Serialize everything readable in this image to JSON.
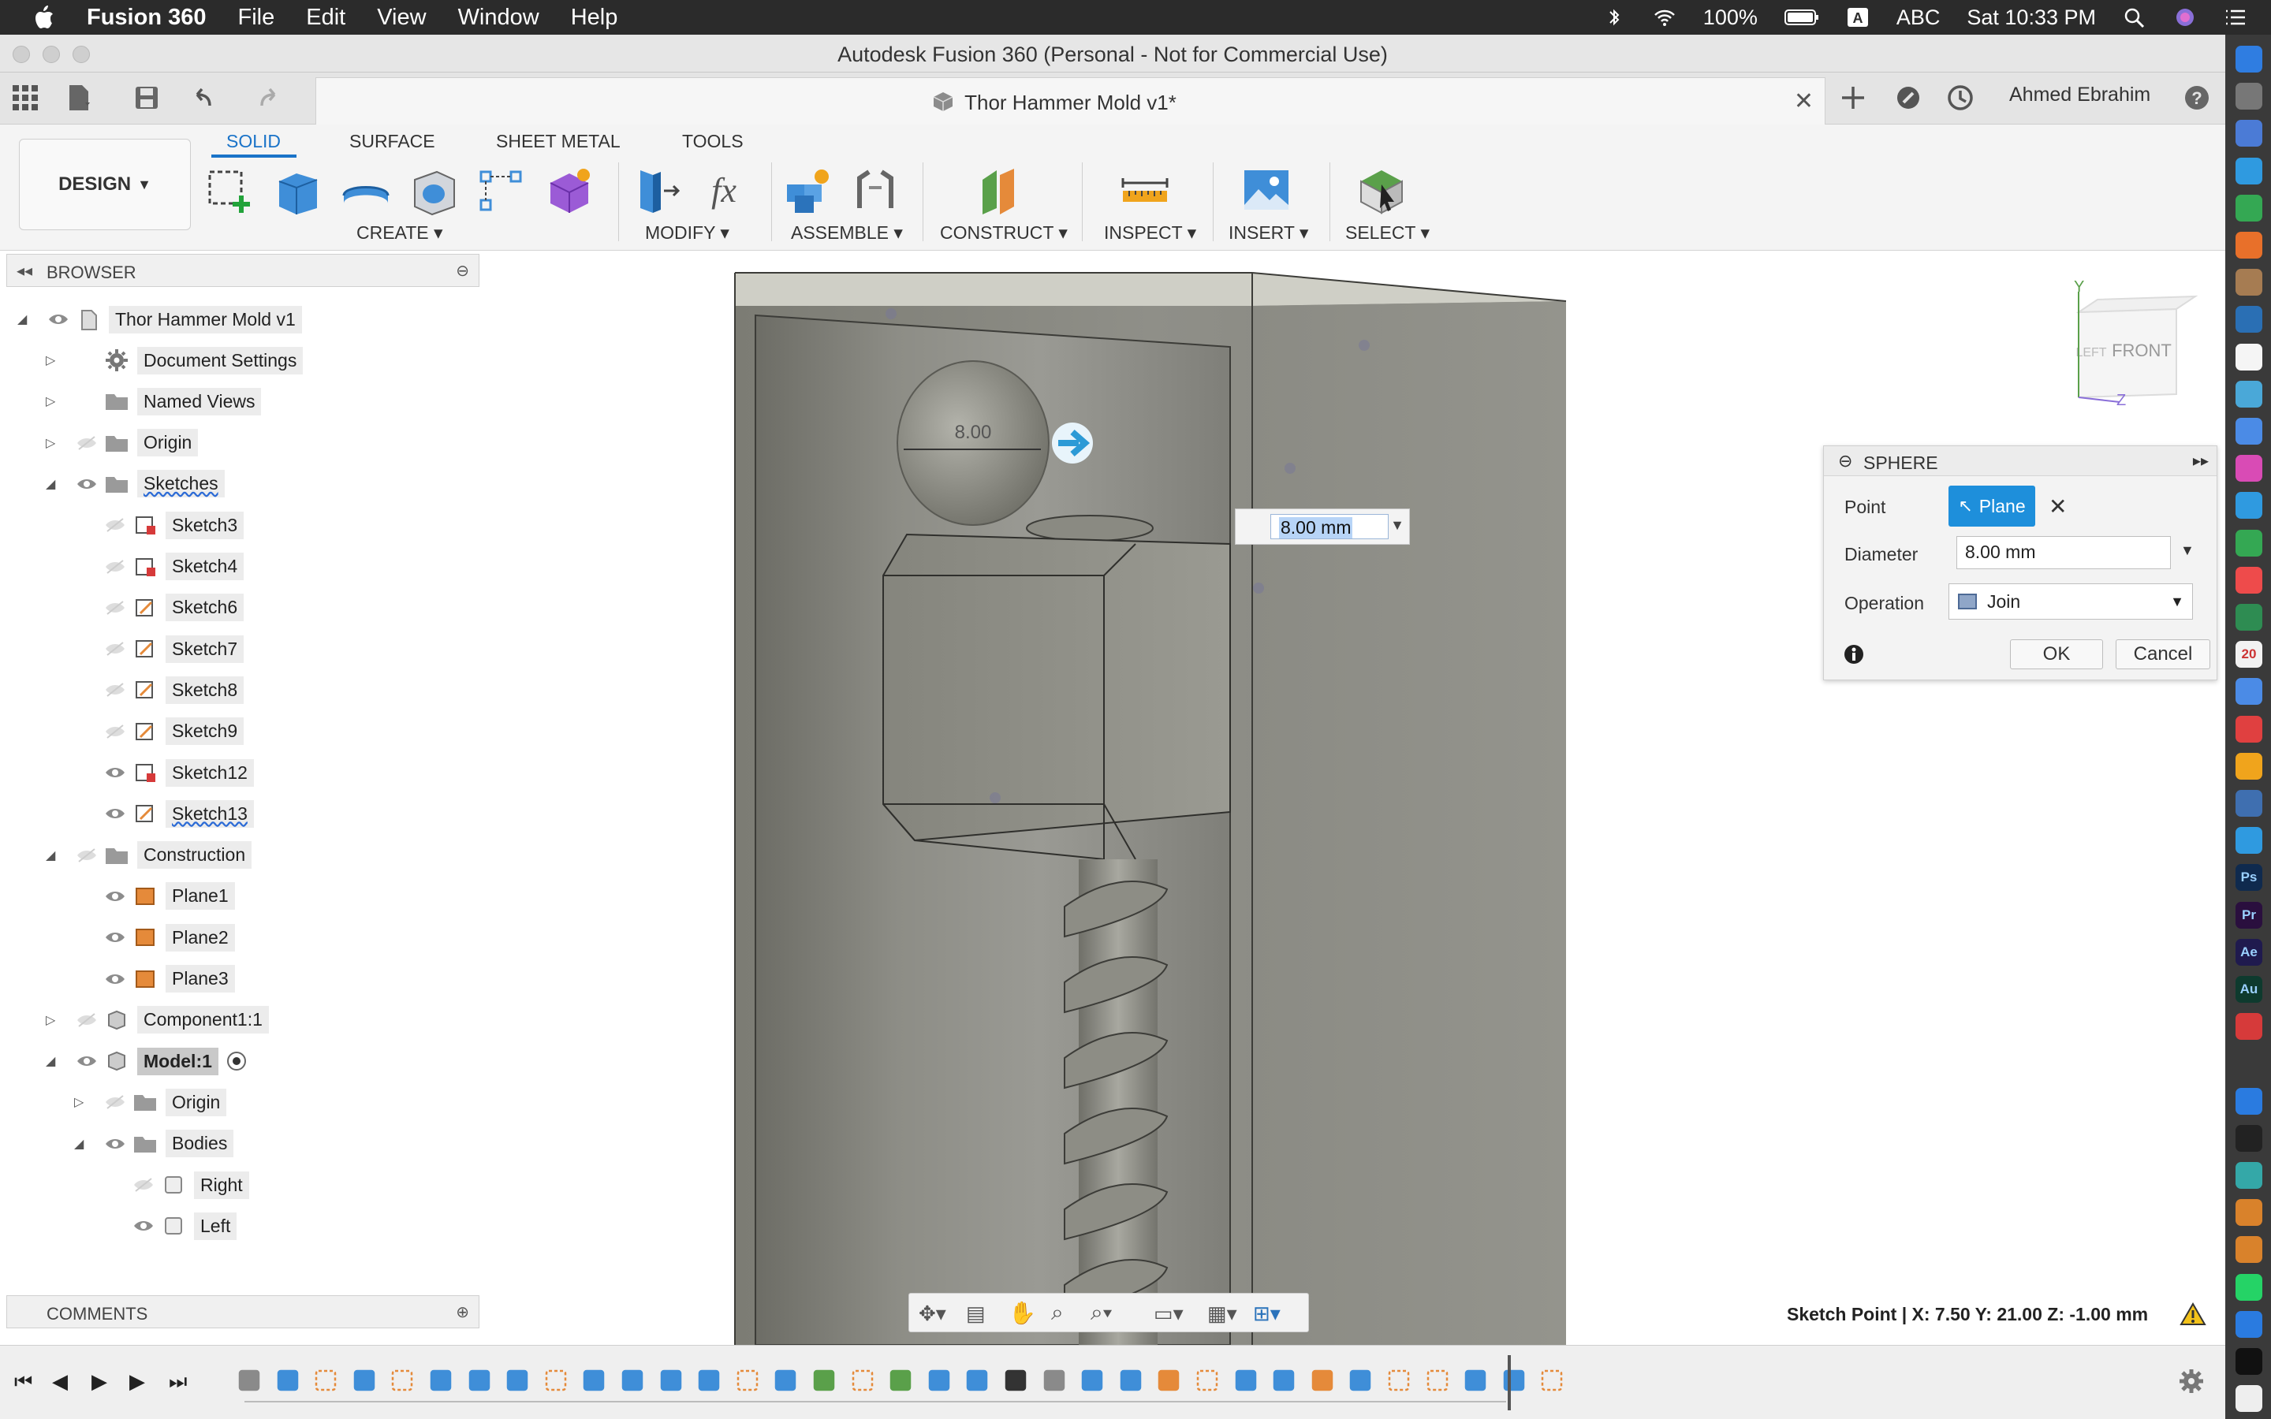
{
  "menubar": {
    "app": "Fusion 360",
    "items": [
      "File",
      "Edit",
      "View",
      "Window",
      "Help"
    ],
    "battery": "100%",
    "input_source": "ABC",
    "clock": "Sat 10:33 PM"
  },
  "window": {
    "title": "Autodesk Fusion 360 (Personal - Not for Commercial Use)",
    "tab_title": "Thor Hammer Mold v1*",
    "user": "Ahmed Ebrahim"
  },
  "toolbar": {
    "workspace": "DESIGN",
    "tabs": [
      "SOLID",
      "SURFACE",
      "SHEET METAL",
      "TOOLS"
    ],
    "groups": [
      "CREATE",
      "MODIFY",
      "ASSEMBLE",
      "CONSTRUCT",
      "INSPECT",
      "INSERT",
      "SELECT"
    ]
  },
  "browser": {
    "title": "BROWSER",
    "root": "Thor Hammer Mold v1",
    "items": [
      {
        "label": "Document Settings"
      },
      {
        "label": "Named Views"
      },
      {
        "label": "Origin"
      },
      {
        "label": "Sketches"
      },
      {
        "label": "Sketch3"
      },
      {
        "label": "Sketch4"
      },
      {
        "label": "Sketch6"
      },
      {
        "label": "Sketch7"
      },
      {
        "label": "Sketch8"
      },
      {
        "label": "Sketch9"
      },
      {
        "label": "Sketch12"
      },
      {
        "label": "Sketch13"
      },
      {
        "label": "Construction"
      },
      {
        "label": "Plane1"
      },
      {
        "label": "Plane2"
      },
      {
        "label": "Plane3"
      },
      {
        "label": "Component1:1"
      },
      {
        "label": "Model:1"
      },
      {
        "label": "Origin"
      },
      {
        "label": "Bodies"
      },
      {
        "label": "Right"
      },
      {
        "label": "Left"
      }
    ]
  },
  "comments": {
    "title": "COMMENTS"
  },
  "viewcube": {
    "left": "LEFT",
    "front": "FRONT",
    "axis_y": "Y",
    "axis_z": "Z"
  },
  "canvas": {
    "diameter_value": "8.00 mm",
    "dimension_label": "8.00"
  },
  "sphere_dialog": {
    "title": "SPHERE",
    "point_label": "Point",
    "point_value": "Plane",
    "diameter_label": "Diameter",
    "diameter_value": "8.00 mm",
    "operation_label": "Operation",
    "operation_value": "Join",
    "ok": "OK",
    "cancel": "Cancel"
  },
  "status": {
    "text": "Sketch Point | X: 7.50 Y: 21.00 Z: -1.00 mm"
  },
  "dock": {
    "labels": [
      "Ps",
      "Pr",
      "Ae",
      "Au",
      "20"
    ]
  },
  "colors": {
    "accent": "#1a73c8",
    "button_blue": "#1e8fdb",
    "model_gray": "#8a8a82",
    "menubar_bg": "#2b2b2b"
  }
}
